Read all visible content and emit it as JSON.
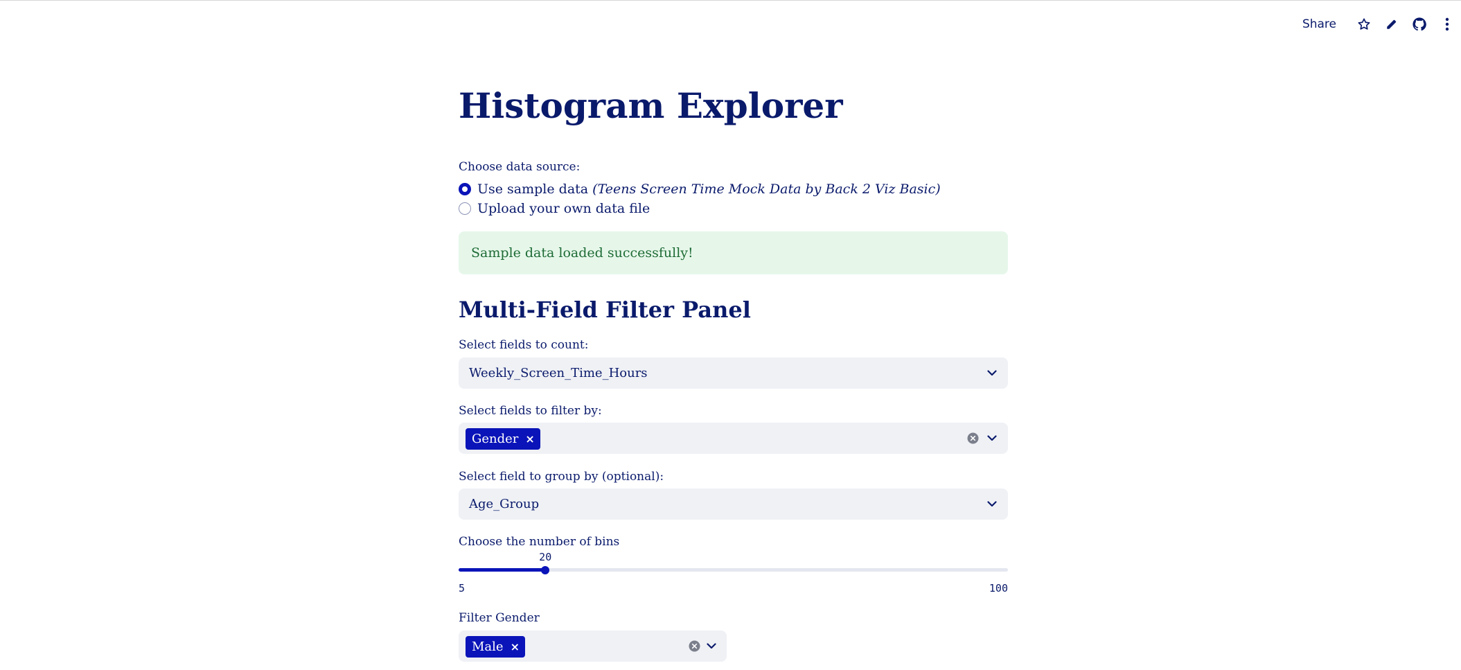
{
  "toolbar": {
    "share_label": "Share",
    "icons": [
      "star-icon",
      "pencil-icon",
      "github-icon",
      "more-vertical-icon"
    ]
  },
  "title": "Histogram Explorer",
  "data_source": {
    "label": "Choose data source:",
    "options": [
      {
        "label": "Use sample data",
        "note": "(Teens Screen Time Mock Data by Back 2 Viz Basic)",
        "selected": true
      },
      {
        "label": "Upload your own data file",
        "note": "",
        "selected": false
      }
    ]
  },
  "success_message": "Sample data loaded successfully!",
  "panel": {
    "heading": "Multi-Field Filter Panel",
    "count_fields": {
      "label": "Select fields to count:",
      "value": "Weekly_Screen_Time_Hours"
    },
    "filter_fields": {
      "label": "Select fields to filter by:",
      "tags": [
        "Gender"
      ]
    },
    "group_by": {
      "label": "Select field to group by (optional):",
      "value": "Age_Group"
    },
    "bins": {
      "label": "Choose the number of bins",
      "value": 20,
      "min": 5,
      "max": 100,
      "value_text": "20",
      "min_text": "5",
      "max_text": "100"
    },
    "filter_gender": {
      "label": "Filter Gender",
      "tags": [
        "Male"
      ]
    }
  },
  "colors": {
    "primary": "#0a14b8",
    "text": "#0a1a6b",
    "success_bg": "#e6f7ea",
    "success_text": "#1e6b35",
    "input_bg": "#eff1f5"
  }
}
